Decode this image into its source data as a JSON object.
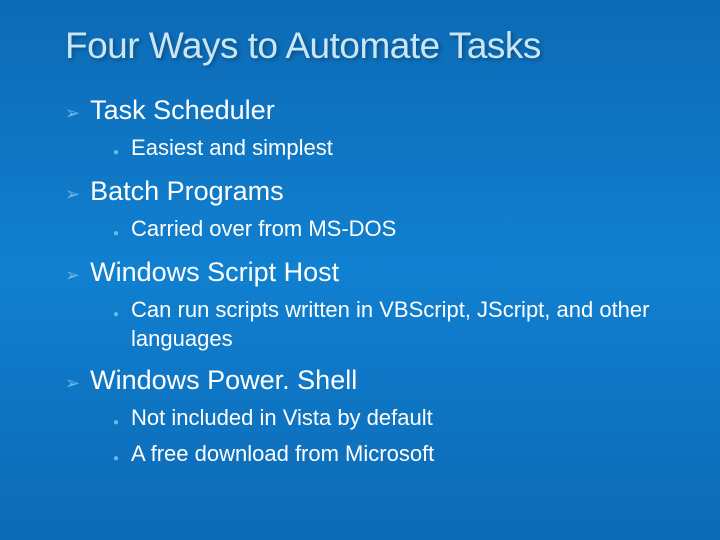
{
  "title": "Four Ways to Automate Tasks",
  "items": [
    {
      "label": "Task Scheduler",
      "subs": [
        {
          "text": "Easiest and simplest"
        }
      ]
    },
    {
      "label": "Batch Programs",
      "subs": [
        {
          "text": "Carried over from MS-DOS"
        }
      ]
    },
    {
      "label": "Windows Script Host",
      "subs": [
        {
          "text": "Can run scripts written in VBScript, JScript, and other languages"
        }
      ]
    },
    {
      "label": "Windows Power. Shell",
      "subs": [
        {
          "text": "Not included in Vista by default"
        },
        {
          "text": "A free download from Microsoft"
        }
      ]
    }
  ]
}
